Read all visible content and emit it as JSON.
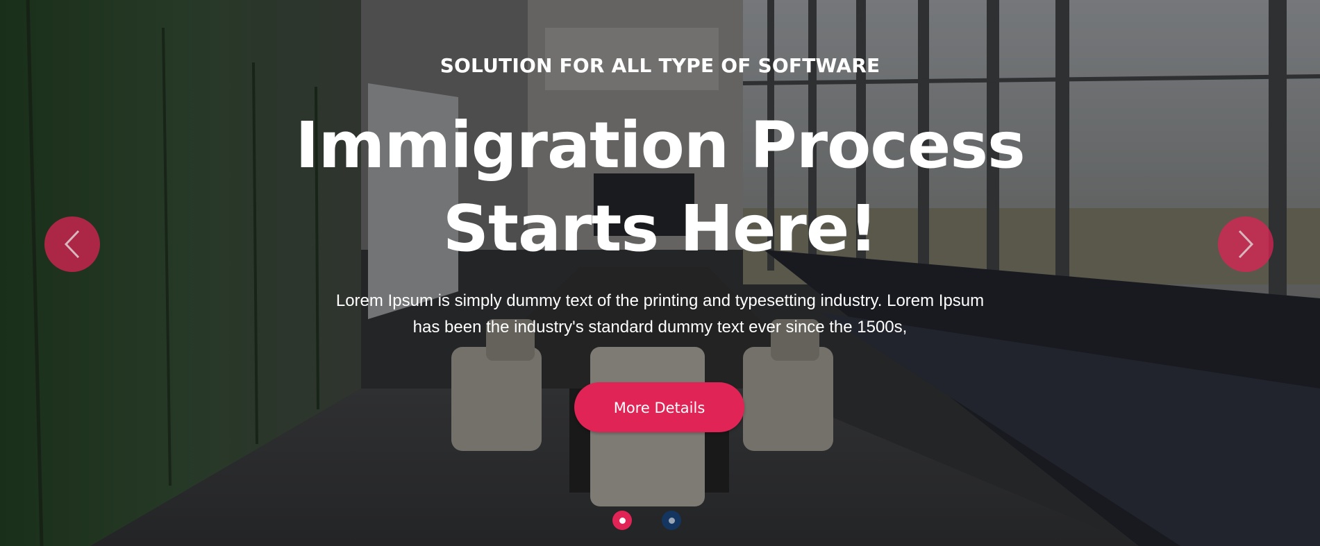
{
  "hero": {
    "kicker": "SOLUTION FOR ALL TYPE OF SOFTWARE",
    "title_line1": "Immigration Process",
    "title_line2": "Starts Here!",
    "description_line1": "Lorem Ipsum is simply dummy text of the printing and typesetting industry. Lorem Ipsum",
    "description_line2": "has been the industry's standard dummy text ever since the 1500s,",
    "button_label": "More Details"
  },
  "carousel": {
    "prev_icon": "chevron-left-icon",
    "next_icon": "chevron-right-icon",
    "slides": 2,
    "active_slide": 1
  },
  "colors": {
    "accent": "#e02455",
    "inactive_dot": "#14355f",
    "text": "#ffffff"
  }
}
